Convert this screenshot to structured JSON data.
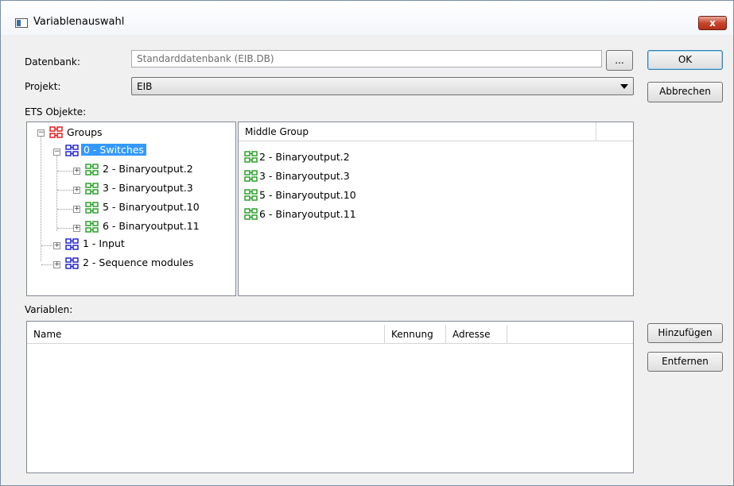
{
  "window": {
    "title": "Variablenauswahl",
    "close_label": "x"
  },
  "form": {
    "datenbank_label": "Datenbank:",
    "datenbank_value": "Standarddatenbank (EIB.DB)",
    "browse_label": "...",
    "projekt_label": "Projekt:",
    "projekt_value": "EIB",
    "ets_label": "ETS Objekte:",
    "variablen_label": "Variablen:"
  },
  "buttons": {
    "ok": "OK",
    "abbrechen": "Abbrechen",
    "hinzufuegen": "Hinzufügen",
    "entfernen": "Entfernen"
  },
  "tree": {
    "root": "Groups",
    "selected": "0 - Switches",
    "children_selected": [
      "2 - Binaryoutput.2",
      "3 - Binaryoutput.3",
      "5 - Binaryoutput.10",
      "6 - Binaryoutput.11"
    ],
    "others": [
      "1 - Input",
      "2 - Sequence modules"
    ]
  },
  "middle": {
    "header": "Middle Group",
    "items": [
      "2 - Binaryoutput.2",
      "3 - Binaryoutput.3",
      "5 - Binaryoutput.10",
      "6 - Binaryoutput.11"
    ]
  },
  "variables_table": {
    "columns": [
      "Name",
      "Kennung",
      "Adresse"
    ]
  },
  "colors": {
    "red_group": "#e01010",
    "blue_group": "#1a1ad0",
    "green_group": "#1f9a1f",
    "selection": "#3399ff"
  }
}
